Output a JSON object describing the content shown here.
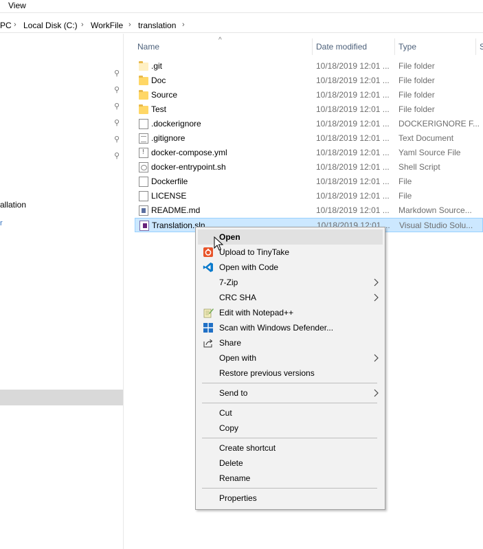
{
  "ribbon": {
    "view_tab": "View"
  },
  "address": {
    "crumbs": [
      "PC",
      "Local Disk (C:)",
      "WorkFile",
      "translation"
    ]
  },
  "nav": {
    "partial_label": "allation",
    "partial_blue": "r"
  },
  "columns": {
    "name": "Name",
    "date": "Date modified",
    "type": "Type",
    "size": "S"
  },
  "files": [
    {
      "name": ".git",
      "date": "10/18/2019 12:01 ...",
      "type": "File folder",
      "icon": "folder-icon"
    },
    {
      "name": "Doc",
      "date": "10/18/2019 12:01 ...",
      "type": "File folder",
      "icon": "folder-icon"
    },
    {
      "name": "Source",
      "date": "10/18/2019 12:01 ...",
      "type": "File folder",
      "icon": "folder-icon"
    },
    {
      "name": "Test",
      "date": "10/18/2019 12:01 ...",
      "type": "File folder",
      "icon": "folder-icon"
    },
    {
      "name": ".dockerignore",
      "date": "10/18/2019 12:01 ...",
      "type": "DOCKERIGNORE F...",
      "icon": "file-icon"
    },
    {
      "name": ".gitignore",
      "date": "10/18/2019 12:01 ...",
      "type": "Text Document",
      "icon": "text-document-icon"
    },
    {
      "name": "docker-compose.yml",
      "date": "10/18/2019 12:01 ...",
      "type": "Yaml Source File",
      "icon": "yaml-file-icon"
    },
    {
      "name": "docker-entrypoint.sh",
      "date": "10/18/2019 12:01 ...",
      "type": "Shell Script",
      "icon": "shell-script-icon"
    },
    {
      "name": "Dockerfile",
      "date": "10/18/2019 12:01 ...",
      "type": "File",
      "icon": "file-icon"
    },
    {
      "name": "LICENSE",
      "date": "10/18/2019 12:01 ...",
      "type": "File",
      "icon": "file-icon"
    },
    {
      "name": "README.md",
      "date": "10/18/2019 12:01 ...",
      "type": "Markdown Source...",
      "icon": "markdown-file-icon"
    },
    {
      "name": "Translation.sln",
      "date": "10/18/2019 12:01 ...",
      "type": "Visual Studio Solu...",
      "icon": "visual-studio-solution-icon"
    }
  ],
  "context_menu": {
    "open": "Open",
    "upload_tinytake": "Upload to TinyTake",
    "open_with_code": "Open with Code",
    "seven_zip": "7-Zip",
    "crc_sha": "CRC SHA",
    "edit_notepadpp": "Edit with Notepad++",
    "scan_defender": "Scan with Windows Defender...",
    "share": "Share",
    "open_with": "Open with",
    "restore_versions": "Restore previous versions",
    "send_to": "Send to",
    "cut": "Cut",
    "copy": "Copy",
    "create_shortcut": "Create shortcut",
    "delete": "Delete",
    "rename": "Rename",
    "properties": "Properties"
  },
  "colors": {
    "selection_bg": "#cce8ff",
    "selection_border": "#99d1ff",
    "menu_bg": "#f2f2f2",
    "header_text": "#4c607a",
    "tinytake": "#e8542a",
    "vscode": "#0a7acc",
    "defender": "#1f6fc5"
  }
}
